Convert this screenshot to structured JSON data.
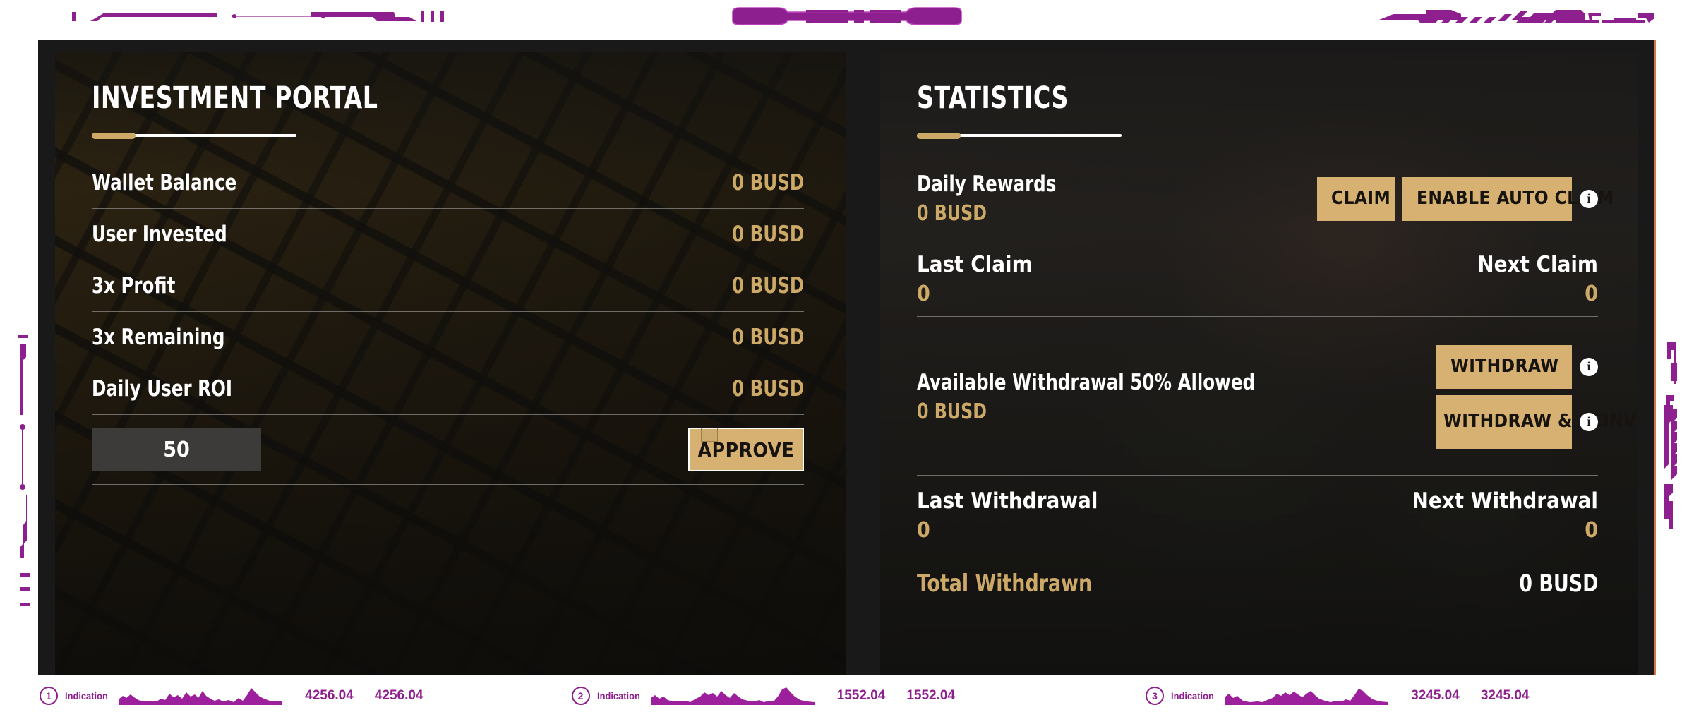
{
  "theme": {
    "gold": "#cda968",
    "gold_button": "#d6b172",
    "purple": "#8e1f8e",
    "panel_bg": "#2b2a28",
    "stage_bg": "#191919",
    "accent_border": "#d07a4a"
  },
  "investment_portal": {
    "title": "INVESTMENT PORTAL",
    "rows": [
      {
        "label": "Wallet Balance",
        "value": "0 BUSD"
      },
      {
        "label": "User Invested",
        "value": "0 BUSD"
      },
      {
        "label": "3x Profit",
        "value": "0 BUSD"
      },
      {
        "label": "3x Remaining",
        "value": "0 BUSD"
      },
      {
        "label": "Daily User ROI",
        "value": "0 BUSD"
      }
    ],
    "amount_input": {
      "value": "50",
      "placeholder": "50"
    },
    "approve_label": "APPROVE"
  },
  "statistics": {
    "title": "STATISTICS",
    "daily_rewards": {
      "label": "Daily Rewards",
      "value": "0 BUSD",
      "claim_label": "CLAIM",
      "auto_claim_label": "ENABLE AUTO CLAIM",
      "info_glyph": "i"
    },
    "claim_times": {
      "last_label": "Last Claim",
      "last_value": "0",
      "next_label": "Next Claim",
      "next_value": "0"
    },
    "available_withdrawal": {
      "label": "Available Withdrawal 50% Allowed",
      "value": "0 BUSD",
      "withdraw_label": "WITHDRAW",
      "withdraw_reinvest_label": "WITHDRAW & REINVEST",
      "info_glyph": "i"
    },
    "withdrawal_times": {
      "last_label": "Last Withdrawal",
      "last_value": "0",
      "next_label": "Next Withdrawal",
      "next_value": "0"
    },
    "total_withdrawn": {
      "label": "Total Withdrawn",
      "value": "0 BUSD"
    }
  },
  "bottom_bar": {
    "indications": [
      {
        "number": "1",
        "label": "Indication",
        "value_a": "4256.04",
        "value_b": "4256.04"
      },
      {
        "number": "2",
        "label": "Indication",
        "value_a": "1552.04",
        "value_b": "1552.04"
      },
      {
        "number": "3",
        "label": "Indication",
        "value_a": "3245.04",
        "value_b": "3245.04"
      }
    ]
  }
}
